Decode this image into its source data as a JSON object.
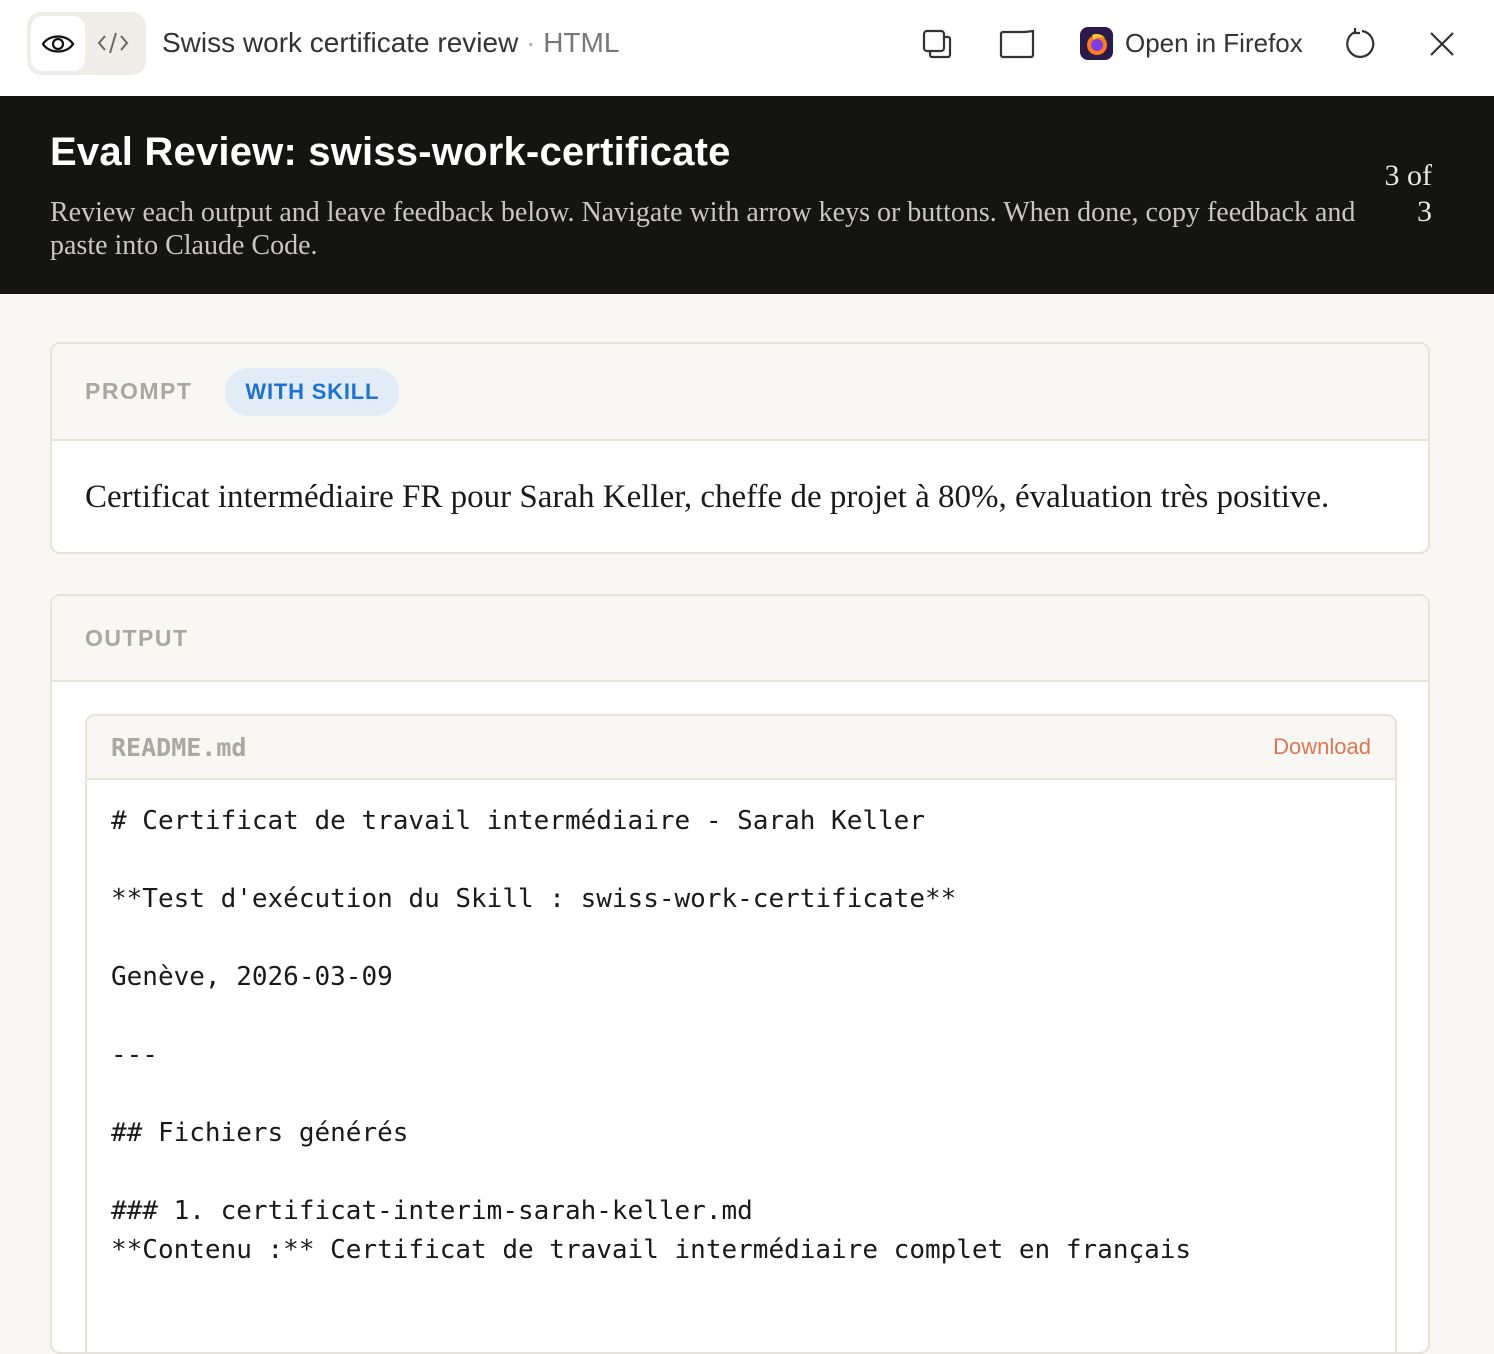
{
  "window": {
    "title": "Swiss work certificate review",
    "separator": "·",
    "kind": "HTML",
    "open_in_label": "Open in Firefox"
  },
  "header": {
    "title": "Eval Review: swiss-work-certificate",
    "subtitle": "Review each output and leave feedback below. Navigate with arrow keys or buttons. When done, copy feedback and paste into Claude Code.",
    "counter": "3 of 3"
  },
  "prompt": {
    "label": "PROMPT",
    "badge": "WITH SKILL",
    "text": "Certificat intermédiaire FR pour Sarah Keller, cheffe de projet à 80%, évaluation très positive."
  },
  "output": {
    "label": "OUTPUT",
    "file": {
      "name": "README.md",
      "download_label": "Download",
      "content": "# Certificat de travail intermédiaire - Sarah Keller\n\n**Test d'exécution du Skill : swiss-work-certificate**\n\nGenève, 2026-03-09\n\n---\n\n## Fichiers générés\n\n### 1. certificat-interim-sarah-keller.md\n**Contenu :** Certificat de travail intermédiaire complet en français"
    }
  },
  "colors": {
    "accent": "#d97757",
    "badge_text": "#1f72d1",
    "hero_bg": "#141413"
  }
}
